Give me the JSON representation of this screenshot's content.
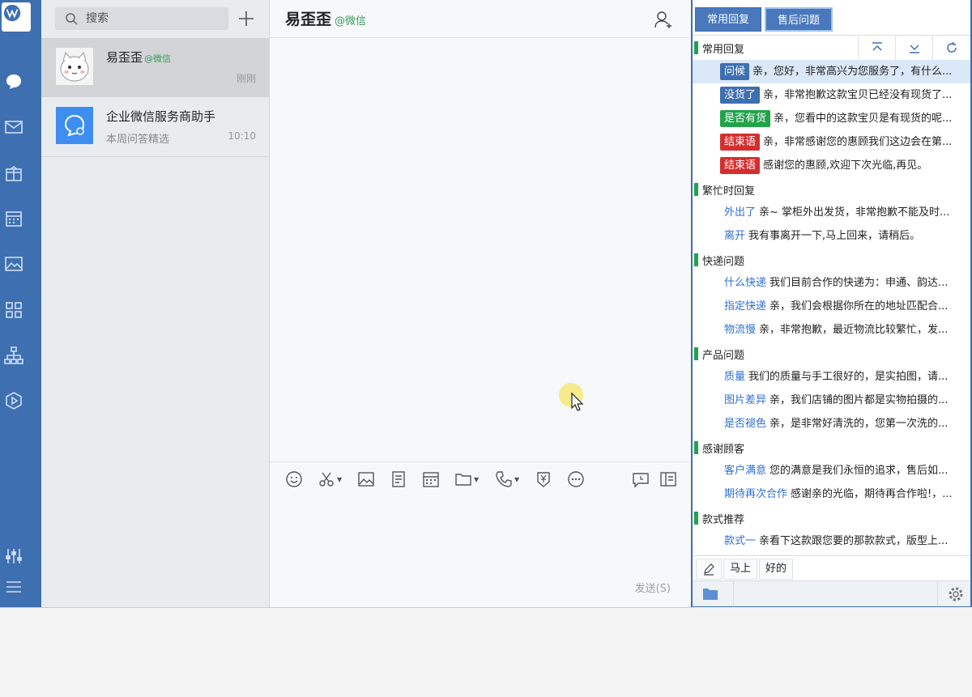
{
  "sidebar": {
    "icons": [
      "chat-icon",
      "mail-icon",
      "gift-box-icon",
      "calendar-icon",
      "image-icon",
      "apps-grid-icon",
      "org-chart-icon",
      "play-hex-icon",
      "settings-sliders-icon",
      "menu-icon"
    ]
  },
  "search": {
    "placeholder": "搜索"
  },
  "conversations": [
    {
      "name": "易歪歪",
      "tag": "@微信",
      "preview": "",
      "time": "刚刚"
    },
    {
      "name": "企业微信服务商助手",
      "tag": "",
      "preview": "本周问答精选",
      "time": "10:10"
    }
  ],
  "chat": {
    "title": "易歪歪",
    "via": "@微信",
    "send_label": "发送(S)"
  },
  "quick_reply": {
    "tabs": [
      "常用回复",
      "售后问题"
    ],
    "groups": [
      {
        "name": "常用回复",
        "items": [
          {
            "label": "问候",
            "style": "blue",
            "text": "亲，您好，非常高兴为您服务了，有什么..."
          },
          {
            "label": "没货了",
            "style": "blue",
            "text": "亲，非常抱歉这款宝贝已经没有现货了..."
          },
          {
            "label": "是否有货",
            "style": "green",
            "text": "亲，您看中的这款宝贝是有现货的呢..."
          },
          {
            "label": "结束语",
            "style": "red",
            "text": "亲，非常感谢您的惠顾我们这边会在第..."
          },
          {
            "label": "结束语",
            "style": "red",
            "text": "感谢您的惠顾,欢迎下次光临,再见。"
          }
        ]
      },
      {
        "name": "繁忙时回复",
        "items": [
          {
            "label": "外出了",
            "style": "plain",
            "text": "亲~ 掌柜外出发货，非常抱歉不能及时..."
          },
          {
            "label": "离开",
            "style": "plain",
            "text": "我有事离开一下,马上回来，请稍后。"
          }
        ]
      },
      {
        "name": "快递问题",
        "items": [
          {
            "label": "什么快递",
            "style": "plain",
            "text": "我们目前合作的快递为：申通、韵达..."
          },
          {
            "label": "指定快递",
            "style": "plain",
            "text": "亲，我们会根据你所在的地址匹配合..."
          },
          {
            "label": "物流慢",
            "style": "plain",
            "text": "亲，非常抱歉，最近物流比较繁忙，发..."
          }
        ]
      },
      {
        "name": "产品问题",
        "items": [
          {
            "label": "质量",
            "style": "plain",
            "text": "我们的质量与手工很好的，是实拍图，请..."
          },
          {
            "label": "图片差异",
            "style": "plain",
            "text": "亲，我们店铺的图片都是实物拍摄的..."
          },
          {
            "label": "是否褪色",
            "style": "plain",
            "text": "亲，是非常好清洗的，您第一次洗的..."
          }
        ]
      },
      {
        "name": "感谢顾客",
        "items": [
          {
            "label": "客户满意",
            "style": "plain",
            "text": "您的满意是我们永恒的追求，售后如..."
          },
          {
            "label": "期待再次合作",
            "style": "plain",
            "text": "感谢亲的光临，期待再合作啦!，..."
          }
        ]
      },
      {
        "name": "款式推荐",
        "items": [
          {
            "label": "款式一",
            "style": "plain",
            "text": "亲看下这款跟您要的那款款式，版型上..."
          }
        ]
      }
    ],
    "quick_chips": [
      "马上",
      "好的"
    ]
  }
}
